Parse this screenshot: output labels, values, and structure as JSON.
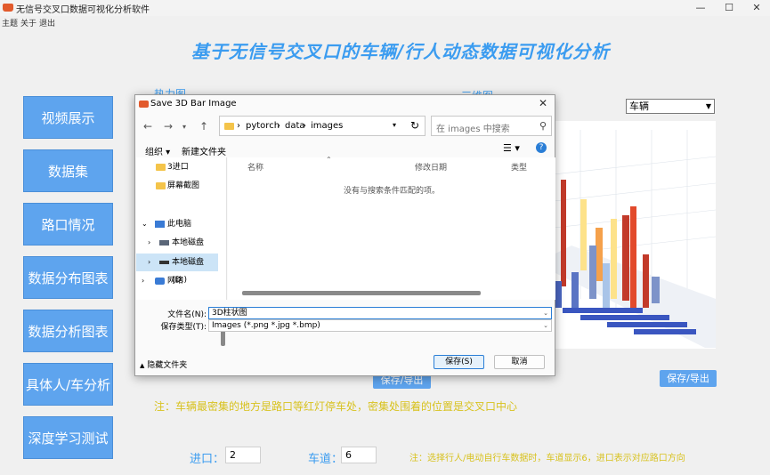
{
  "window": {
    "title": "无信号交叉口数据可视化分析软件",
    "minimize": "—",
    "maximize": "☐",
    "close": "✕"
  },
  "menu": [
    "主题",
    "关于",
    "退出"
  ],
  "main_title": "基于无信号交叉口的车辆/行人动态数据可视化分析",
  "sidebar": [
    {
      "label": "视频展示"
    },
    {
      "label": "数据集"
    },
    {
      "label": "路口情况"
    },
    {
      "label": "数据分布图表"
    },
    {
      "label": "数据分析图表"
    },
    {
      "label": "具体人/车分析"
    },
    {
      "label": "深度学习测试"
    }
  ],
  "heatmap_label": "热力图",
  "chart3d_label": "三维图",
  "type_select": {
    "value": "车辆"
  },
  "save_export_left": "保存/导出",
  "save_export_right": "保存/导出",
  "note_main": "注：车辆最密集的地方是路口等红灯停车处，密集处围着的位置是交叉口中心",
  "entry": {
    "label": "进口：",
    "value": "2"
  },
  "lane": {
    "label": "车道：",
    "value": "6"
  },
  "note_bottom": "注：选择行人/电动自行车数据时，车道显示6，进口表示对应路口方向",
  "dialog": {
    "title": "Save 3D Bar Image",
    "breadcrumb": [
      "pytorch",
      "data",
      "images"
    ],
    "search_placeholder": "在 images 中搜索",
    "organize": "组织 ▾",
    "new_folder": "新建文件夹",
    "nav": [
      {
        "label": "3进口"
      },
      {
        "label": "屏幕截图"
      },
      {
        "label": "此电脑"
      },
      {
        "label": "本地磁盘 (C:)"
      },
      {
        "label": "本地磁盘 (D:)"
      },
      {
        "label": "网络"
      }
    ],
    "columns": {
      "name": "名称",
      "modified": "修改日期",
      "type": "类型"
    },
    "empty_message": "没有与搜索条件匹配的项。",
    "filename_label": "文件名(N):",
    "filename_value": "3D柱状图",
    "filetype_label": "保存类型(T):",
    "filetype_value": "Images (*.png *.jpg *.bmp)",
    "hide_folders": "隐藏文件夹",
    "save_button": "保存(S)",
    "cancel_button": "取消"
  }
}
